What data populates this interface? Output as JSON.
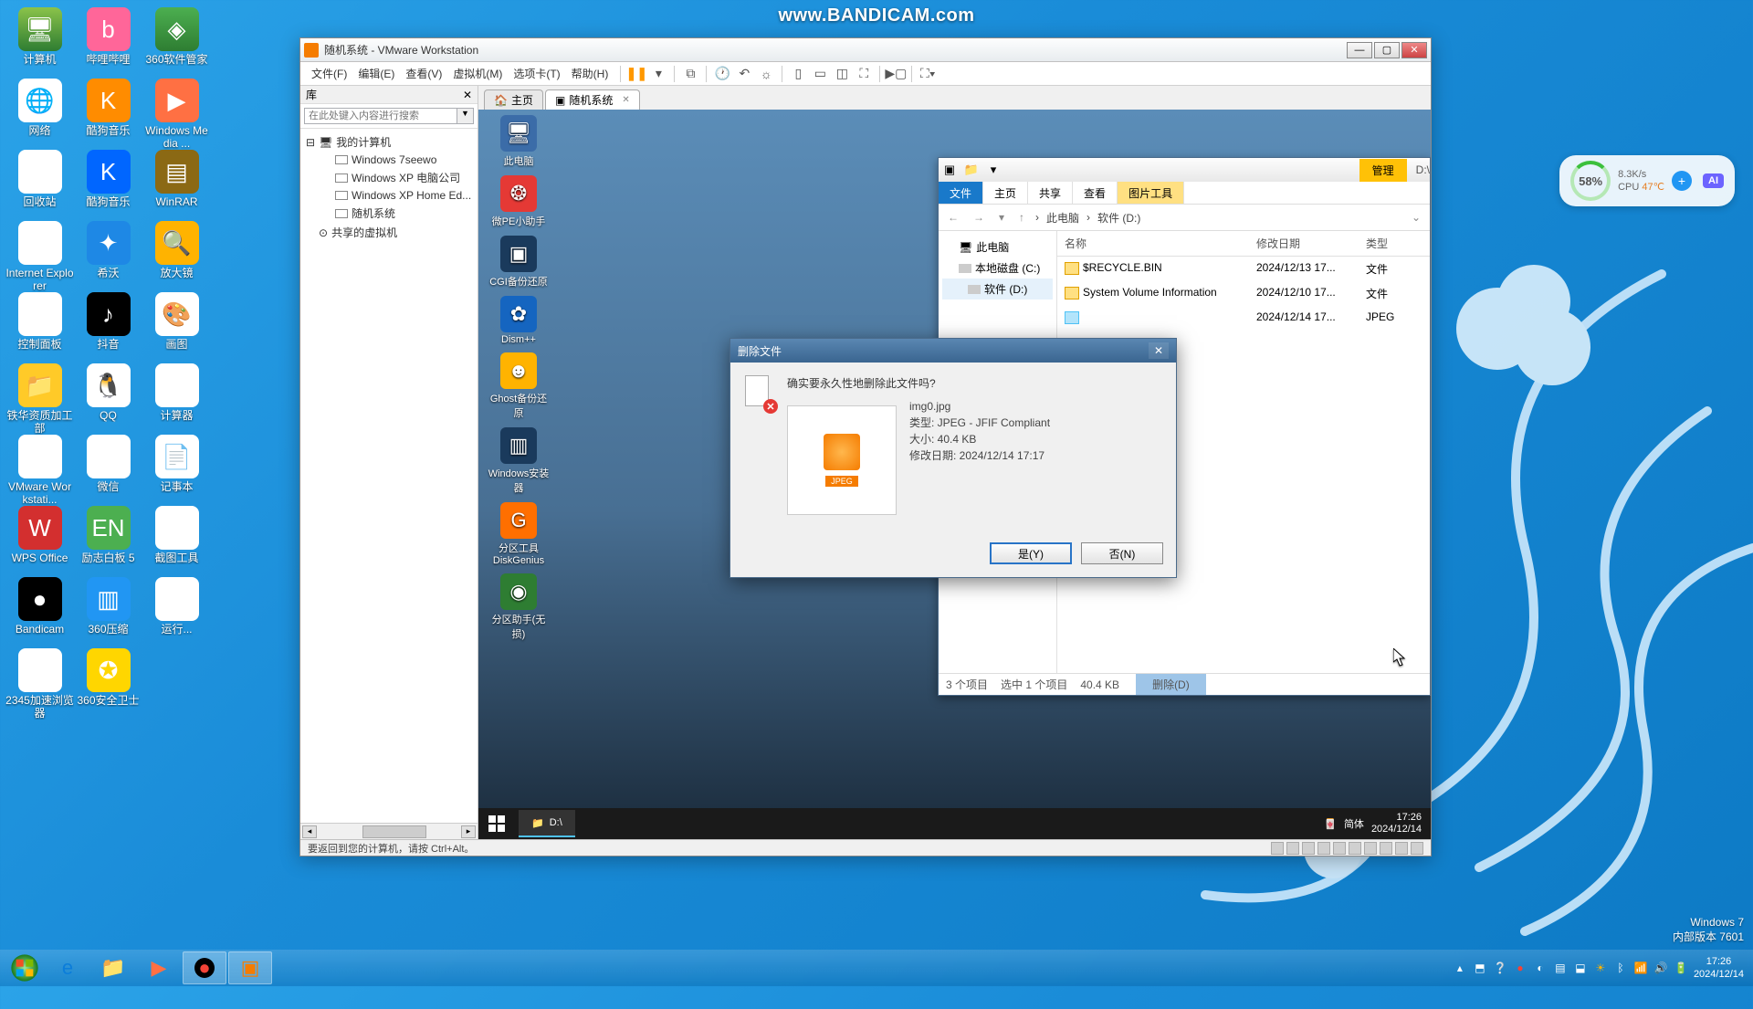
{
  "watermark": "www.BANDICAM.com",
  "host_icons": [
    {
      "label": "计算机",
      "cls": "ic-pc",
      "g": "🖥"
    },
    {
      "label": "哔哩哔哩",
      "cls": "ic-bili",
      "g": "b"
    },
    {
      "label": "360软件管家",
      "cls": "ic-360",
      "g": "◈"
    },
    {
      "label": "网络",
      "cls": "ic-net",
      "g": "🌐"
    },
    {
      "label": "酷狗音乐",
      "cls": "ic-kugou",
      "g": "K"
    },
    {
      "label": "Windows Media ...",
      "cls": "ic-wmp",
      "g": "▶"
    },
    {
      "label": "回收站",
      "cls": "ic-recy",
      "g": "🗑"
    },
    {
      "label": "酷狗音乐",
      "cls": "ic-k2",
      "g": "K"
    },
    {
      "label": "WinRAR",
      "cls": "ic-rar",
      "g": "▤"
    },
    {
      "label": "Internet Explorer",
      "cls": "ic-ie",
      "g": "e"
    },
    {
      "label": "希沃",
      "cls": "ic-xi",
      "g": "✦"
    },
    {
      "label": "放大镜",
      "cls": "ic-fd",
      "g": "🔍"
    },
    {
      "label": "控制面板",
      "cls": "ic-cp",
      "g": "⚙"
    },
    {
      "label": "抖音",
      "cls": "ic-dy",
      "g": "♪"
    },
    {
      "label": "画图",
      "cls": "ic-paint",
      "g": "🎨"
    },
    {
      "label": "铁华资质加工部",
      "cls": "ic-fold",
      "g": "📁"
    },
    {
      "label": "QQ",
      "cls": "ic-qq",
      "g": "🐧"
    },
    {
      "label": "计算器",
      "cls": "ic-cal",
      "g": "▦"
    },
    {
      "label": "VMware Workstati...",
      "cls": "ic-vm",
      "g": "▣"
    },
    {
      "label": "微信",
      "cls": "ic-wc",
      "g": "✆"
    },
    {
      "label": "记事本",
      "cls": "ic-note",
      "g": "📄"
    },
    {
      "label": "WPS Office",
      "cls": "ic-wps",
      "g": "W"
    },
    {
      "label": "励志白板 5",
      "cls": "ic-en",
      "g": "EN"
    },
    {
      "label": "截图工具",
      "cls": "ic-cut",
      "g": "✂"
    },
    {
      "label": "Bandicam",
      "cls": "ic-bc",
      "g": "●"
    },
    {
      "label": "360压缩",
      "cls": "ic-zip",
      "g": "▥"
    },
    {
      "label": "运行...",
      "cls": "ic-run",
      "g": "▶"
    },
    {
      "label": "2345加速浏览器",
      "cls": "ic-234",
      "g": "e"
    },
    {
      "label": "360安全卫士",
      "cls": "ic-360b",
      "g": "✪"
    }
  ],
  "syswidget": {
    "ai": "AI",
    "pct": "58%",
    "net": "8.3K/s",
    "cpu_label": "CPU",
    "cpu": "47℃"
  },
  "vmware": {
    "title": "随机系统 - VMware Workstation",
    "menus": [
      "文件(F)",
      "编辑(E)",
      "查看(V)",
      "虚拟机(M)",
      "选项卡(T)",
      "帮助(H)"
    ],
    "side_header": "库",
    "search_placeholder": "在此处键入内容进行搜索",
    "tree": {
      "root": "我的计算机",
      "items": [
        "Windows 7seewo",
        "Windows XP 电脑公司",
        "Windows XP Home Ed...",
        "随机系统"
      ],
      "shared": "共享的虚拟机"
    },
    "tabs": {
      "home": "主页",
      "vm": "随机系统"
    },
    "status": "要返回到您的计算机，请按 Ctrl+Alt。"
  },
  "vm_icons": [
    {
      "label": "此电脑",
      "cls": "vib1",
      "g": "🖥"
    },
    {
      "label": "微PE小助手",
      "cls": "vib2",
      "g": "❂"
    },
    {
      "label": "CGI备份还原",
      "cls": "vib3",
      "g": "▣"
    },
    {
      "label": "Dism++",
      "cls": "vib4",
      "g": "✿"
    },
    {
      "label": "Ghost备份还原",
      "cls": "vib5",
      "g": "☻"
    },
    {
      "label": "Windows安装器",
      "cls": "vib6",
      "g": "▥"
    },
    {
      "label": "分区工具DiskGenius",
      "cls": "vib7",
      "g": "G"
    },
    {
      "label": "分区助手(无损)",
      "cls": "vib8",
      "g": "◉"
    }
  ],
  "explorer": {
    "manage": "管理",
    "path_short": "D:\\",
    "ribbon": [
      "文件",
      "主页",
      "共享",
      "查看",
      "图片工具"
    ],
    "breadcrumb": [
      "此电脑",
      "软件 (D:)"
    ],
    "nav_items": [
      "此电脑",
      "本地磁盘 (C:)",
      "软件 (D:)"
    ],
    "cols": {
      "name": "名称",
      "date": "修改日期",
      "type": "类型"
    },
    "rows": [
      {
        "name": "$RECYCLE.BIN",
        "date": "2024/12/13 17...",
        "type": "文件"
      },
      {
        "name": "System Volume Information",
        "date": "2024/12/10 17...",
        "type": "文件"
      },
      {
        "name": "",
        "date": "2024/12/14 17...",
        "type": "JPEG"
      }
    ],
    "status": {
      "count": "3 个项目",
      "sel": "选中 1 个项目",
      "size": "40.4 KB",
      "del": "删除(D)"
    }
  },
  "dialog": {
    "title": "删除文件",
    "question": "确实要永久性地删除此文件吗?",
    "filename": "img0.jpg",
    "meta": [
      "类型: JPEG - JFIF Compliant",
      "大小: 40.4 KB",
      "修改日期: 2024/12/14 17:17"
    ],
    "thumb_label": "JPEG",
    "yes": "是(Y)",
    "no": "否(N)"
  },
  "vm_taskbar": {
    "app": "D:\\",
    "ime_icon": "简",
    "ime": "简体",
    "time": "17:26",
    "date": "2024/12/14"
  },
  "host_taskbar": {
    "time": "17:26",
    "date": "2024/12/14"
  },
  "winbrand": {
    "a": "Windows 7",
    "b": "内部版本 7601"
  }
}
